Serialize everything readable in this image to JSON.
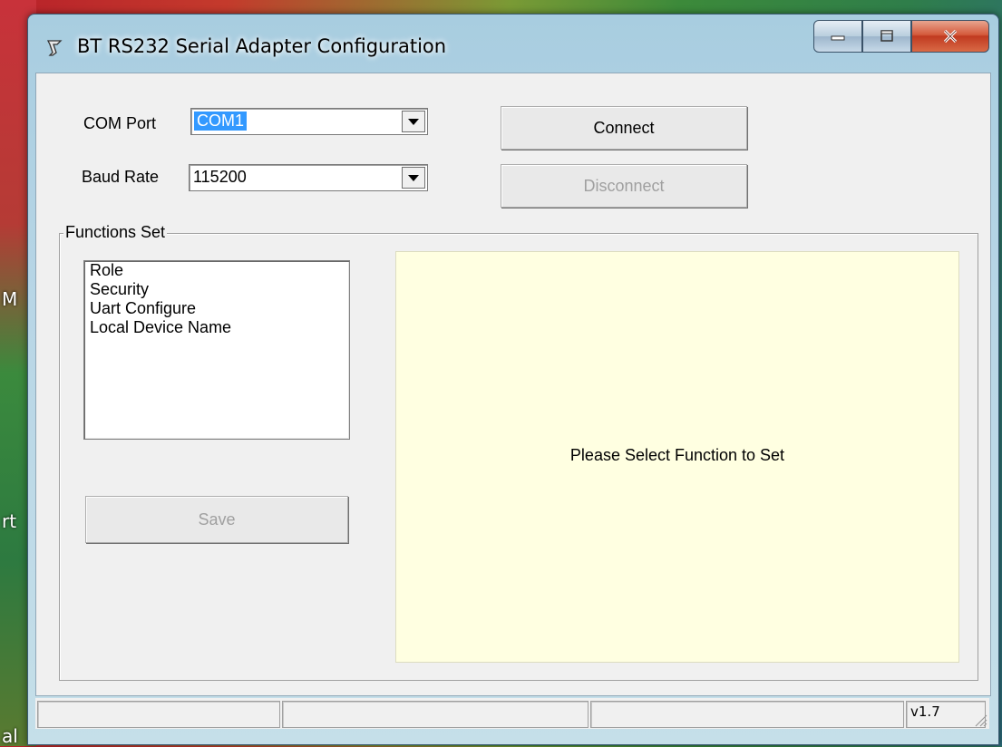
{
  "desktop": {
    "text_m": "M",
    "text_rt": "rt",
    "text_al": "al"
  },
  "window": {
    "title": "BT RS232 Serial Adapter Configuration",
    "controls": {
      "minimize": "minimize-icon",
      "maximize": "maximize-icon",
      "close": "close-icon"
    }
  },
  "connection": {
    "com_port_label": "COM Port",
    "com_port_value": "COM1",
    "baud_rate_label": "Baud Rate",
    "baud_rate_value": "115200",
    "connect_label": "Connect",
    "disconnect_label": "Disconnect"
  },
  "functions": {
    "group_label": "Functions Set",
    "items": [
      {
        "label": "Role"
      },
      {
        "label": "Security"
      },
      {
        "label": "Uart Configure"
      },
      {
        "label": "Local Device Name"
      }
    ],
    "save_label": "Save",
    "panel_message": "Please Select Function to Set"
  },
  "statusbar": {
    "version": "v1.7"
  },
  "colors": {
    "panel_bg": "#ffffe1",
    "selection": "#3399ff"
  }
}
